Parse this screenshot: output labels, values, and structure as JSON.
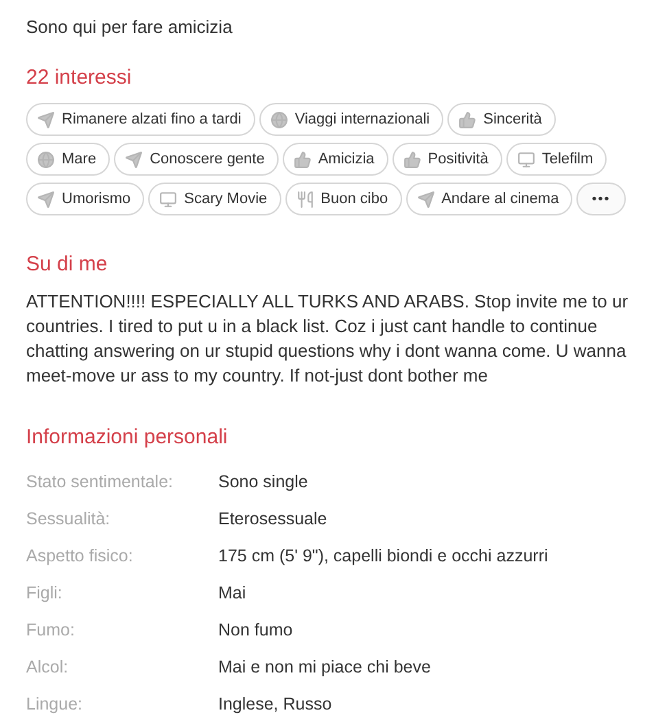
{
  "status_line": "Sono qui per fare amicizia",
  "interests": {
    "title": "22 interessi",
    "tags": [
      {
        "kind": "plane",
        "label": "Rimanere alzati fino a tardi"
      },
      {
        "kind": "globe",
        "label": "Viaggi internazionali"
      },
      {
        "kind": "thumb",
        "label": "Sincerità"
      },
      {
        "kind": "globe",
        "label": "Mare"
      },
      {
        "kind": "plane",
        "label": "Conoscere gente"
      },
      {
        "kind": "thumb",
        "label": "Amicizia"
      },
      {
        "kind": "thumb",
        "label": "Positività"
      },
      {
        "kind": "tv",
        "label": "Telefilm"
      },
      {
        "kind": "plane",
        "label": "Umorismo"
      },
      {
        "kind": "tv",
        "label": "Scary Movie"
      },
      {
        "kind": "food",
        "label": "Buon cibo"
      },
      {
        "kind": "plane",
        "label": "Andare al cinema"
      }
    ],
    "more": "•••"
  },
  "about": {
    "title": "Su di me",
    "text": "ATTENTION!!!! ESPECIALLY ALL TURKS AND ARABS. Stop invite me to ur countries. I tired to put u in a black list. Coz i just cant handle to continue chatting answering on ur stupid questions why i dont wanna come. U wanna meet-move ur ass to my country. If not-just dont bother me"
  },
  "personal": {
    "title": "Informazioni personali",
    "rows": [
      {
        "label": "Stato sentimentale:",
        "value": "Sono single"
      },
      {
        "label": "Sessualità:",
        "value": "Eterosessuale"
      },
      {
        "label": "Aspetto fisico:",
        "value": "175 cm (5' 9\"), capelli biondi e occhi azzurri"
      },
      {
        "label": "Figli:",
        "value": "Mai"
      },
      {
        "label": "Fumo:",
        "value": "Non fumo"
      },
      {
        "label": "Alcol:",
        "value": "Mai e non mi piace chi beve"
      },
      {
        "label": "Lingue:",
        "value": "Inglese, Russo"
      }
    ]
  }
}
